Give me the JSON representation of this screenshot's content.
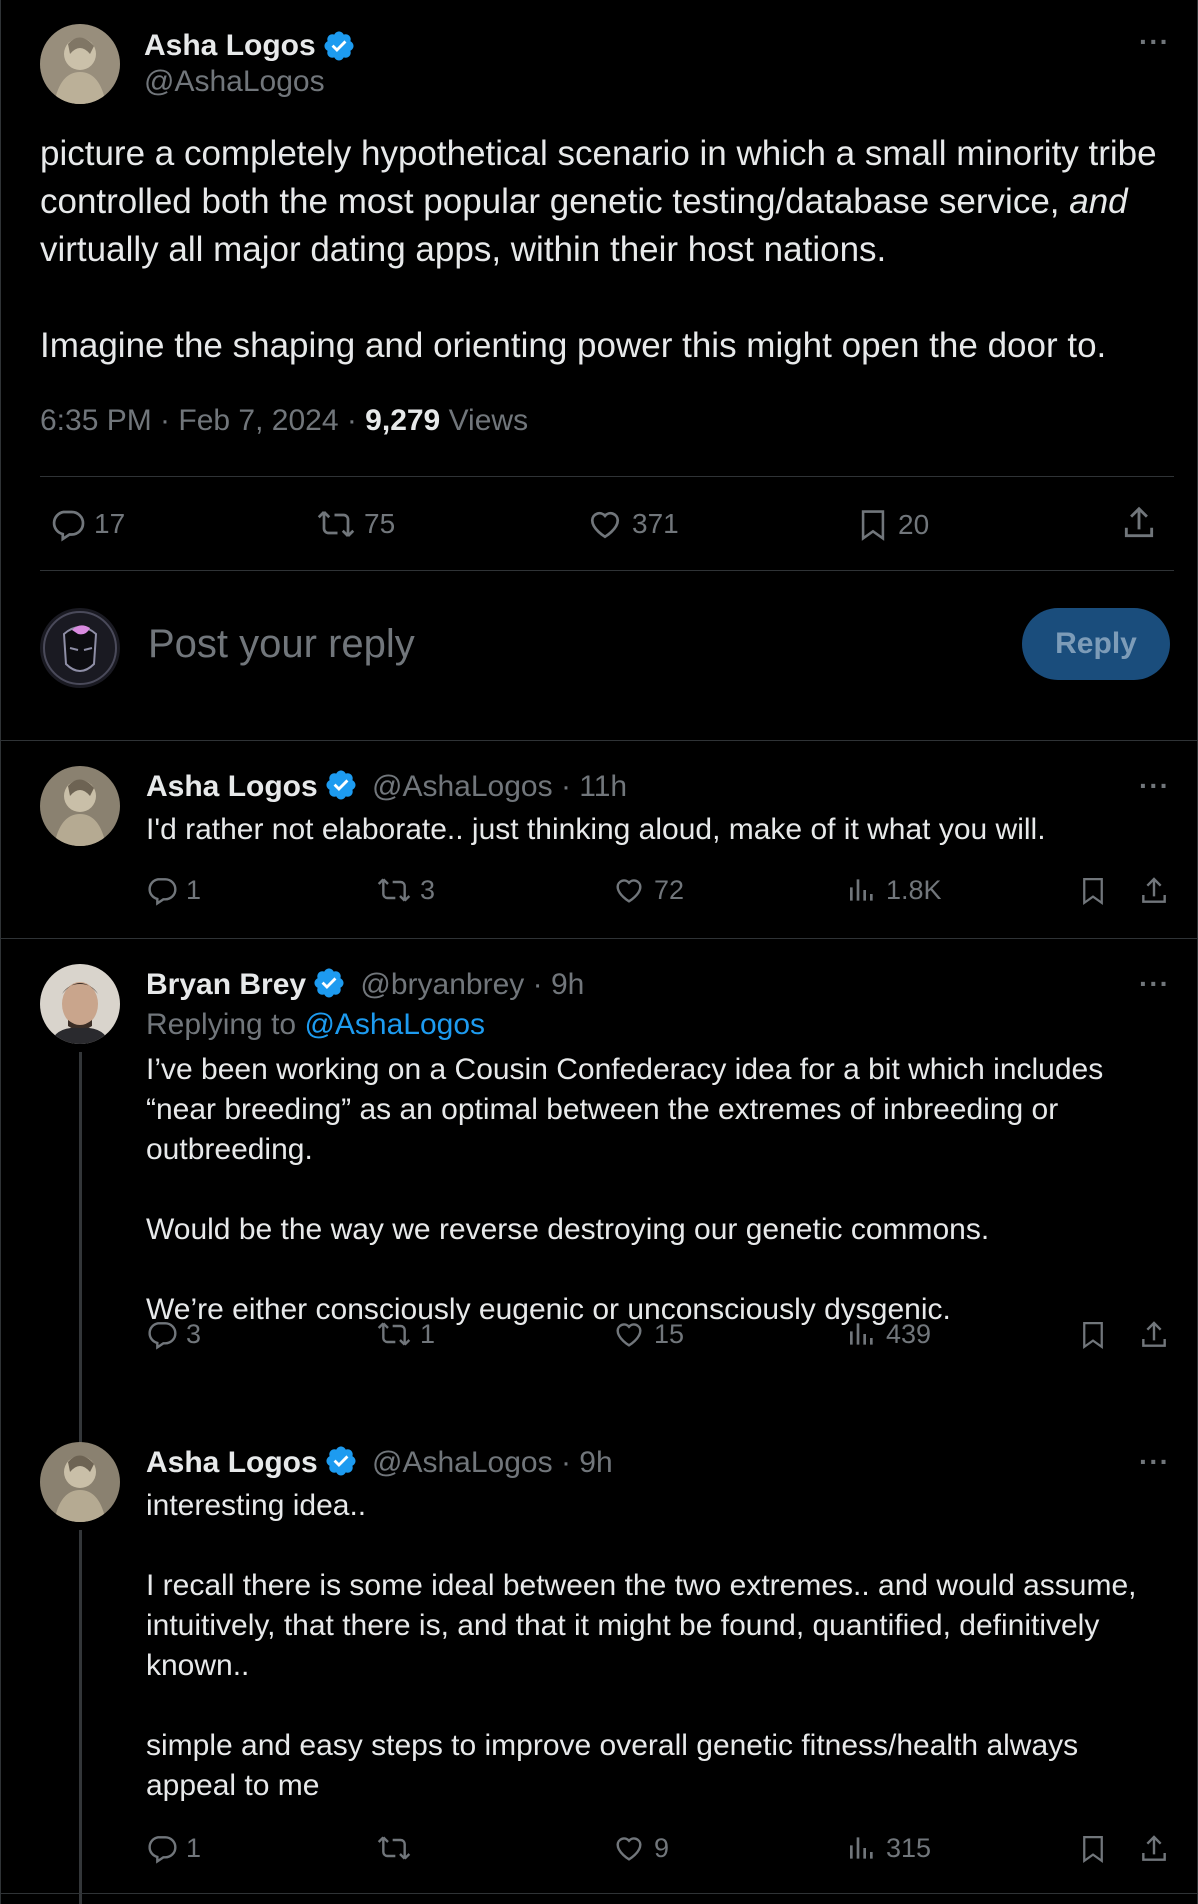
{
  "main_tweet": {
    "author_name": "Asha Logos",
    "author_handle": "@AshaLogos",
    "more_label": "···",
    "text_line1": "picture a completely hypothetical scenario in which a small minority tribe controlled both the most popular genetic testing/database service,",
    "text_em": "and",
    "text_line2": " virtually all major dating apps, within their host nations.",
    "text_para2": "Imagine the shaping and orienting power this might open the door to.",
    "time": "6:35 PM · Feb 7, 2024 · ",
    "views_count": "9,279",
    "views_label": " Views",
    "replies": "17",
    "reposts": "75",
    "likes": "371",
    "bookmarks": "20"
  },
  "composer": {
    "placeholder": "Post your reply",
    "button": "Reply"
  },
  "replies": [
    {
      "author_name": "Asha Logos",
      "author_handle": "@AshaLogos",
      "time": " · 11h",
      "paragraphs": [
        "I'd rather not elaborate.. just thinking aloud, make of it what you will."
      ],
      "replies": "1",
      "reposts": "3",
      "likes": "72",
      "views": "1.8K"
    },
    {
      "author_name": "Bryan Brey",
      "author_handle": "@bryanbrey",
      "time": " · 9h",
      "replying_prefix": "Replying to ",
      "replying_to": "@AshaLogos",
      "paragraphs": [
        "I’ve been working on a Cousin Confederacy idea for a bit which includes “near breeding” as an optimal between the extremes of inbreeding or outbreeding.",
        "Would be the way we reverse destroying our genetic commons.",
        "We’re either consciously eugenic or unconsciously dysgenic."
      ],
      "replies": "3",
      "reposts": "1",
      "likes": "15",
      "views": "439"
    },
    {
      "author_name": "Asha Logos",
      "author_handle": "@AshaLogos",
      "time": " · 9h",
      "paragraphs": [
        "interesting idea..",
        "I recall there is some ideal between the two extremes.. and would assume, intuitively, that there is, and that it might be found, quantified, definitively known..",
        "simple and easy steps to improve overall genetic fitness/health always appeal to me"
      ],
      "replies": "1",
      "reposts": "",
      "likes": "9",
      "views": "315"
    }
  ],
  "colors": {
    "background": "#000000",
    "text": "#e7e9ea",
    "muted": "#71767b",
    "accent": "#1d9bf0",
    "divider": "#2f3336"
  },
  "icons": [
    "verified-badge-icon",
    "reply-icon",
    "repost-icon",
    "like-icon",
    "bookmark-icon",
    "share-icon",
    "views-icon",
    "more-icon"
  ]
}
